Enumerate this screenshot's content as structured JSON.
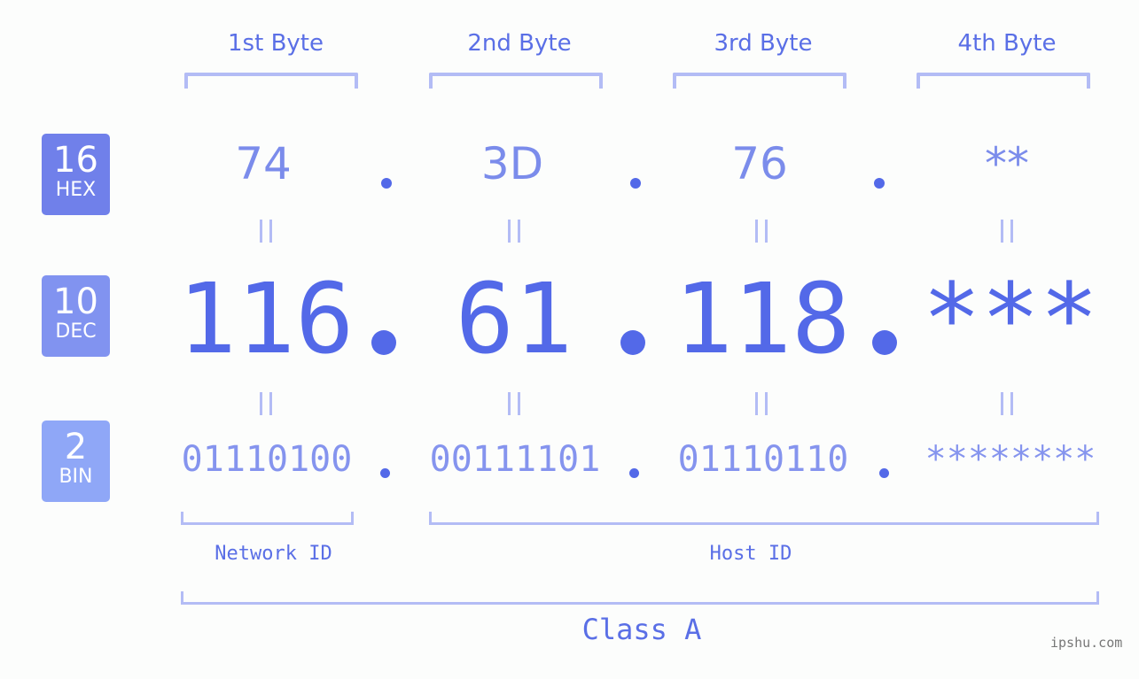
{
  "byte_headers": [
    "1st Byte",
    "2nd Byte",
    "3rd Byte",
    "4th Byte"
  ],
  "rows": {
    "hex": {
      "base": "16",
      "label": "HEX",
      "values": [
        "74",
        "3D",
        "76",
        "**"
      ],
      "badge_color": "#7080ea"
    },
    "dec": {
      "base": "10",
      "label": "DEC",
      "values": [
        "116",
        "61",
        "118",
        "***"
      ],
      "badge_color": "#8193f0"
    },
    "bin": {
      "base": "2",
      "label": "BIN",
      "values": [
        "01110100",
        "00111101",
        "01110110",
        "********"
      ],
      "badge_color": "#8fa7f7"
    }
  },
  "separator": ".",
  "equals": "||",
  "network_label": "Network ID",
  "host_label": "Host ID",
  "class_label": "Class A",
  "brand": "ipshu.com",
  "colors": {
    "accent": "#5369e8",
    "bracket": "#b3bcf5",
    "text": "#5a6fe6"
  }
}
